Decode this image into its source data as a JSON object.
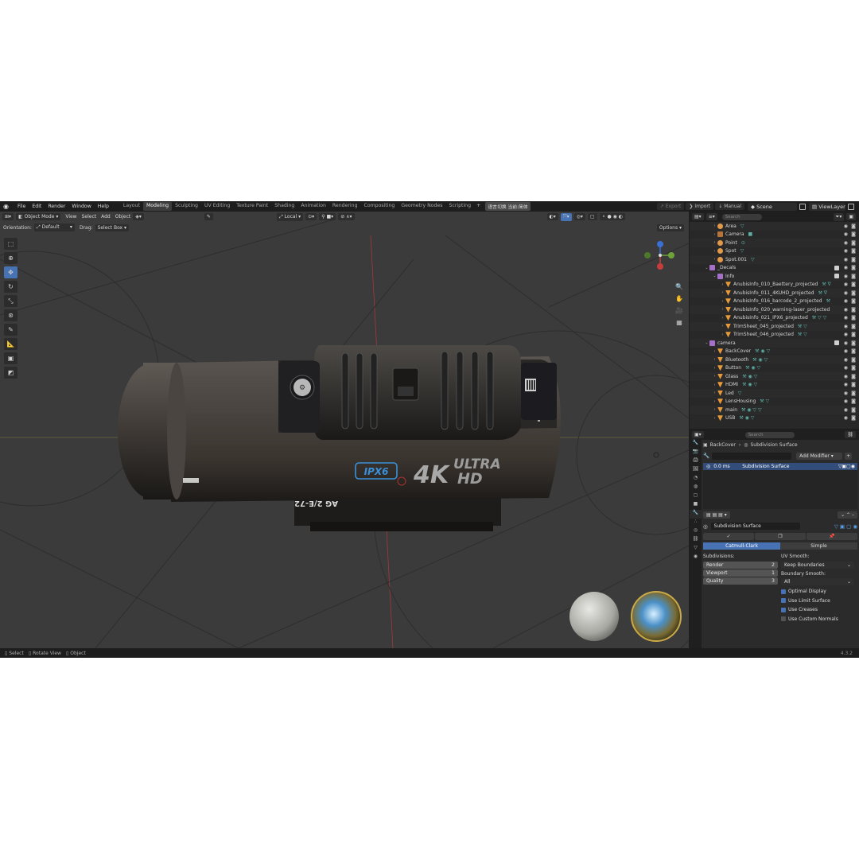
{
  "menu": [
    "File",
    "Edit",
    "Render",
    "Window",
    "Help"
  ],
  "workspaces": [
    "Layout",
    "Modeling",
    "Sculpting",
    "UV Editing",
    "Texture Paint",
    "Shading",
    "Animation",
    "Rendering",
    "Compositing",
    "Geometry Nodes",
    "Scripting"
  ],
  "active_workspace": "Modeling",
  "ws_extra": "语言切换 当前:简体",
  "top_right": {
    "export": "Export",
    "import": "Import",
    "manual": "Manual",
    "scene": "Scene",
    "view_layer": "ViewLayer"
  },
  "viewport_header": {
    "mode": "Object Mode",
    "menus": [
      "View",
      "Select",
      "Add",
      "Object"
    ],
    "transform": "Local"
  },
  "viewport_header2": {
    "orientation_label": "Orientation:",
    "orientation": "Default",
    "drag_label": "Drag:",
    "drag": "Select Box",
    "options": "Options"
  },
  "product_text": {
    "badge": "IPX6",
    "k4": "4K",
    "ultra": "ULTRA",
    "hd": "HD",
    "serial": "AG 2/E-72"
  },
  "outliner": {
    "search_placeholder": "Search",
    "rows": [
      {
        "name": "Area",
        "indent": 1,
        "icon": "light",
        "mods": "▽"
      },
      {
        "name": "Camera",
        "indent": 1,
        "icon": "camera",
        "mods": "■"
      },
      {
        "name": "Point",
        "indent": 1,
        "icon": "light",
        "mods": "⊙"
      },
      {
        "name": "Spot",
        "indent": 1,
        "icon": "light",
        "mods": "▽"
      },
      {
        "name": "Spot.001",
        "indent": 1,
        "icon": "light",
        "mods": "▽"
      },
      {
        "name": "_Decals",
        "indent": 0,
        "icon": "collection",
        "mods": ""
      },
      {
        "name": "Info",
        "indent": 1,
        "icon": "collection",
        "mods": ""
      },
      {
        "name": "AnubisInfo_010_Baettery_projected",
        "indent": 2,
        "icon": "mesh",
        "mods": "⚒ ∇"
      },
      {
        "name": "AnubisInfo_011_4KUHD_projected",
        "indent": 2,
        "icon": "mesh",
        "mods": "⚒ ∇"
      },
      {
        "name": "AnubisInfo_016_barcode_2_projected",
        "indent": 2,
        "icon": "mesh",
        "mods": "⚒"
      },
      {
        "name": "AnubisInfo_020_warning-laser_projected",
        "indent": 2,
        "icon": "mesh",
        "mods": ""
      },
      {
        "name": "AnubisInfo_021_IPX6_projected",
        "indent": 2,
        "icon": "mesh",
        "mods": "⚒ ▽ ▽"
      },
      {
        "name": "TrimSheet_045_projected",
        "indent": 2,
        "icon": "mesh",
        "mods": "⚒ ▽"
      },
      {
        "name": "TrimSheet_046_projected",
        "indent": 2,
        "icon": "mesh",
        "mods": "⚒ ▽"
      },
      {
        "name": "camera",
        "indent": 0,
        "icon": "collection",
        "mods": ""
      },
      {
        "name": "BackCover",
        "indent": 1,
        "icon": "mesh",
        "mods": "⚒ ◉ ▽"
      },
      {
        "name": "Bluetooth",
        "indent": 1,
        "icon": "mesh",
        "mods": "⚒ ◉ ▽"
      },
      {
        "name": "Button",
        "indent": 1,
        "icon": "mesh",
        "mods": "⚒ ◉ ▽"
      },
      {
        "name": "Glass",
        "indent": 1,
        "icon": "mesh",
        "mods": "⚒ ◉ ▽"
      },
      {
        "name": "HDMI",
        "indent": 1,
        "icon": "mesh",
        "mods": "⚒ ◉ ▽"
      },
      {
        "name": "Led",
        "indent": 1,
        "icon": "mesh",
        "mods": "▽"
      },
      {
        "name": "LensHousing",
        "indent": 1,
        "icon": "mesh",
        "mods": "⚒ ▽"
      },
      {
        "name": "main",
        "indent": 1,
        "icon": "mesh",
        "mods": "⚒ ◉ ▽ ▽"
      },
      {
        "name": "USB",
        "indent": 1,
        "icon": "mesh",
        "mods": "⚒ ◉ ▽"
      }
    ]
  },
  "properties": {
    "search_placeholder": "Search",
    "object": "BackCover",
    "modifier_crumb": "Subdivision Surface",
    "add_modifier": "Add Modifier",
    "stack_time": "0.0 ms",
    "stack_name": "Subdivision Surface",
    "modifier_name": "Subdivision Surface",
    "algo_a": "Catmull-Clark",
    "algo_b": "Simple",
    "subdivisions_label": "Subdivisions:",
    "render_label": "Render",
    "render_value": "2",
    "viewport_label": "Viewport",
    "viewport_value": "1",
    "quality_label": "Quality",
    "quality_value": "3",
    "uv_smooth_label": "UV Smooth:",
    "uv_smooth": "Keep Boundaries",
    "boundary_smooth_label": "Boundary Smooth:",
    "boundary_smooth": "All",
    "checks": [
      {
        "label": "Optimal Display",
        "on": true
      },
      {
        "label": "Use Limit Surface",
        "on": true
      },
      {
        "label": "Use Creases",
        "on": true
      },
      {
        "label": "Use Custom Normals",
        "on": false
      }
    ]
  },
  "status": {
    "select": "Select",
    "rotate": "Rotate View",
    "object": "Object",
    "version": "4.3.2"
  },
  "colors": {
    "accent": "#4772b3",
    "axis_red": "#c83c3c",
    "axis_green": "#6fa33a",
    "axis_blue": "#3a6fd4"
  }
}
